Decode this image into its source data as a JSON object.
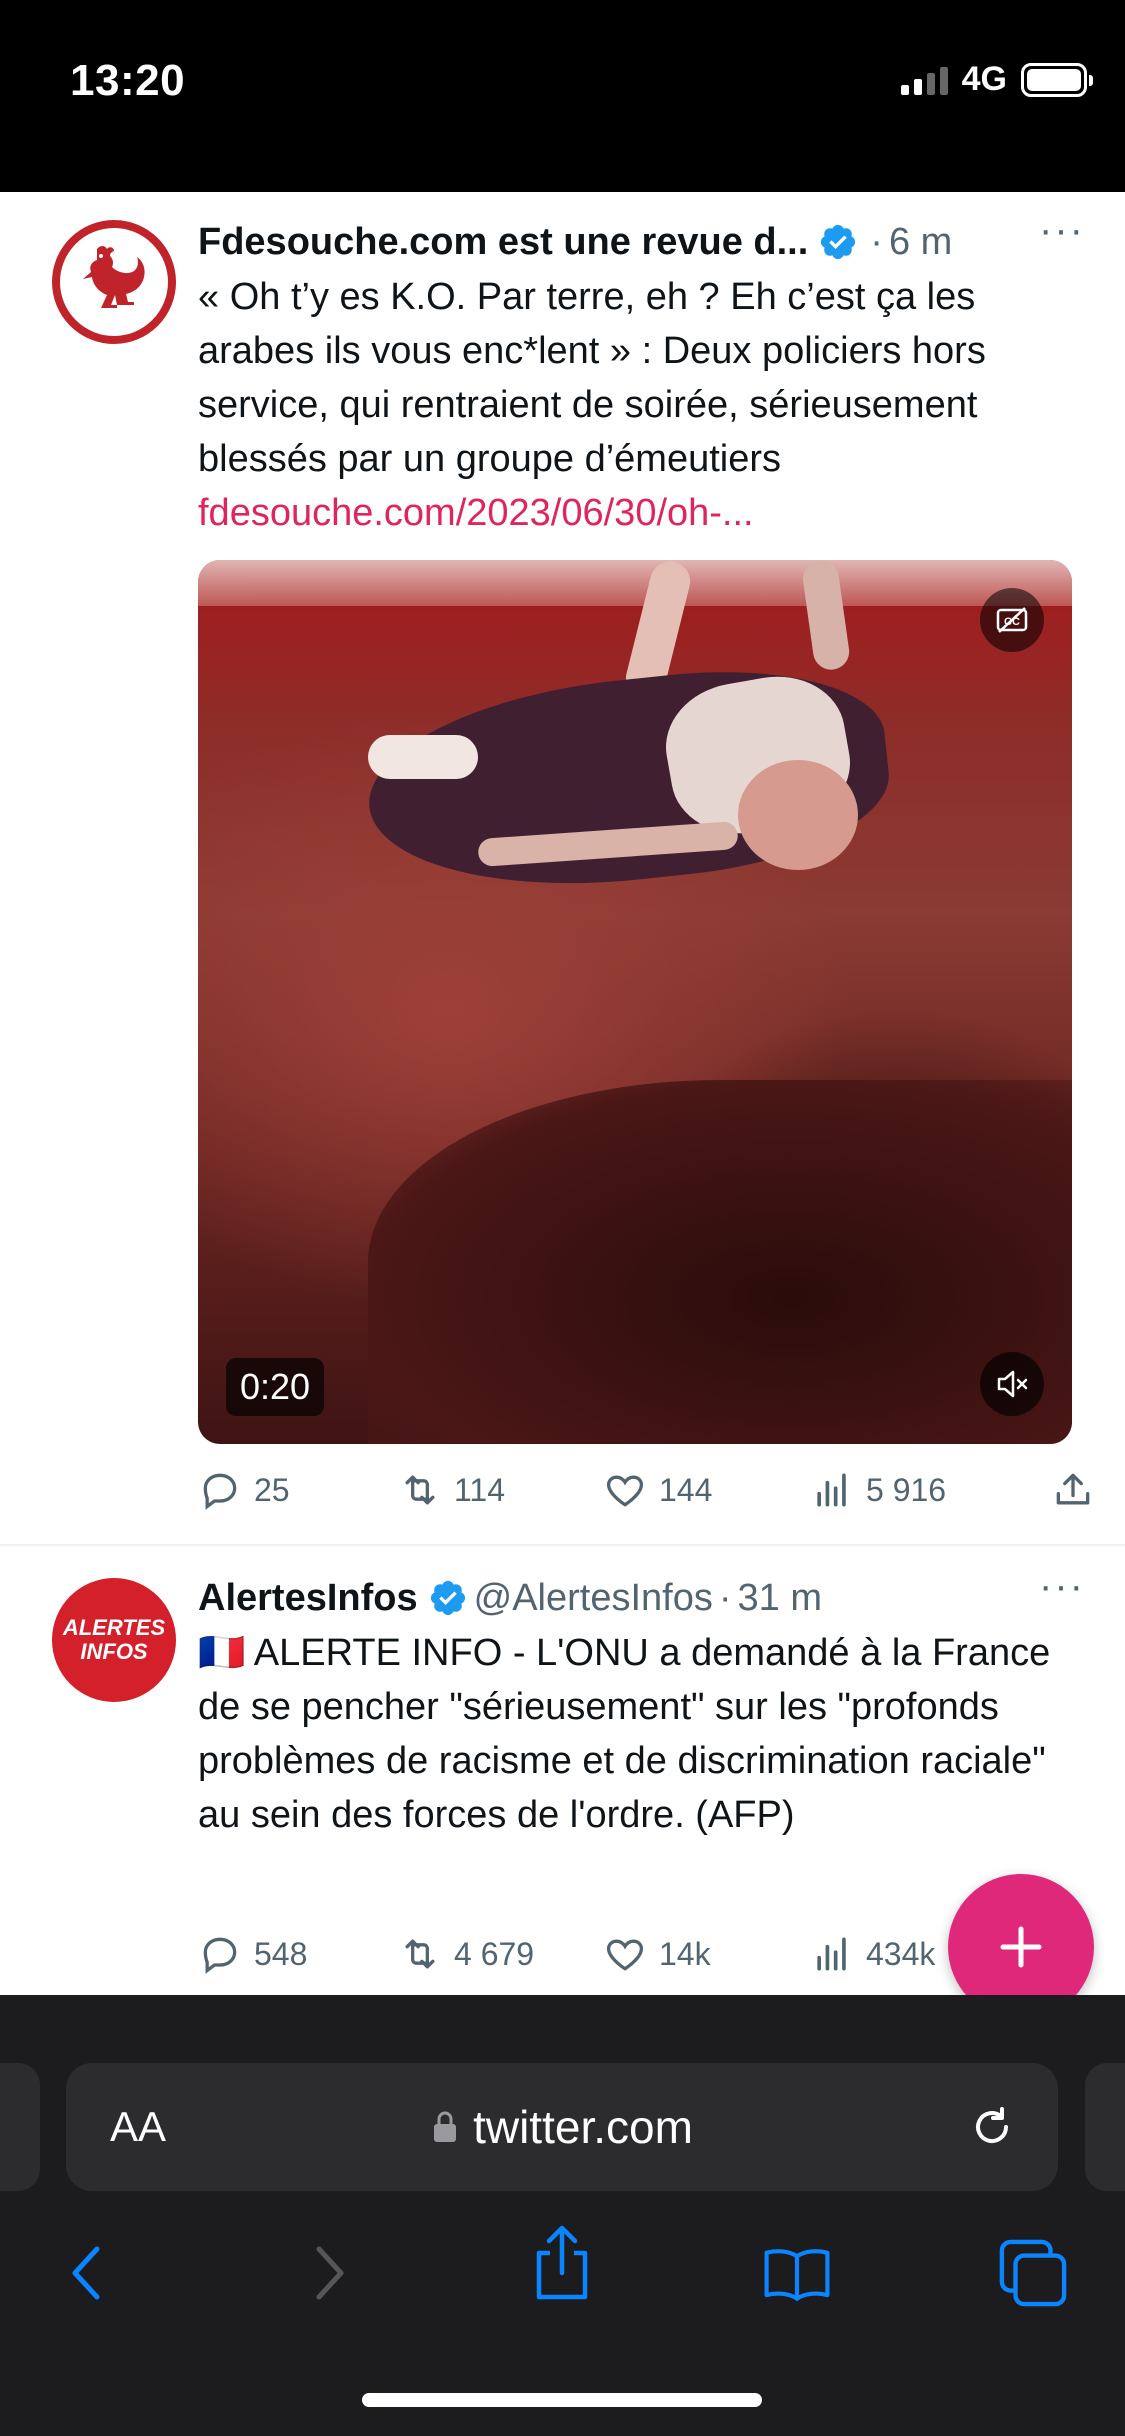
{
  "status_bar": {
    "time": "13:20",
    "network": "4G"
  },
  "tweets": [
    {
      "author": "Fdesouche.com est une revue d...",
      "handle": "",
      "time_ago": "6 m",
      "text": "« Oh t’y es K.O. Par terre, eh ? Eh c’est ça les arabes ils vous enc*lent » : Deux policiers hors service, qui rentraient de soirée, sérieusement blessés par un groupe d’émeutiers",
      "link": "fdesouche.com/2023/06/30/oh-...",
      "video_duration": "0:20",
      "replies": "25",
      "retweets": "114",
      "likes": "144",
      "views": "5 916"
    },
    {
      "author": "AlertesInfos",
      "handle": "@AlertesInfos",
      "time_ago": "31 m",
      "avatar_line1": "ALERTES",
      "avatar_line2": "INFOS",
      "flag": "🇫🇷",
      "text": "ALERTE INFO - L'ONU a demandé à la France de se pencher \"sérieusement\" sur les \"profonds problèmes de racisme et de discrimination raciale\" au sein des forces de l'ordre. (AFP)",
      "replies": "548",
      "retweets": "4 679",
      "likes": "14k",
      "views": "434k"
    }
  ],
  "browser": {
    "aa_label": "AA",
    "url": "twitter.com"
  },
  "colors": {
    "accent": "#e0287a",
    "verified": "#1d9bf0",
    "link": "#e0245e",
    "ios_blue": "#0a84ff"
  }
}
